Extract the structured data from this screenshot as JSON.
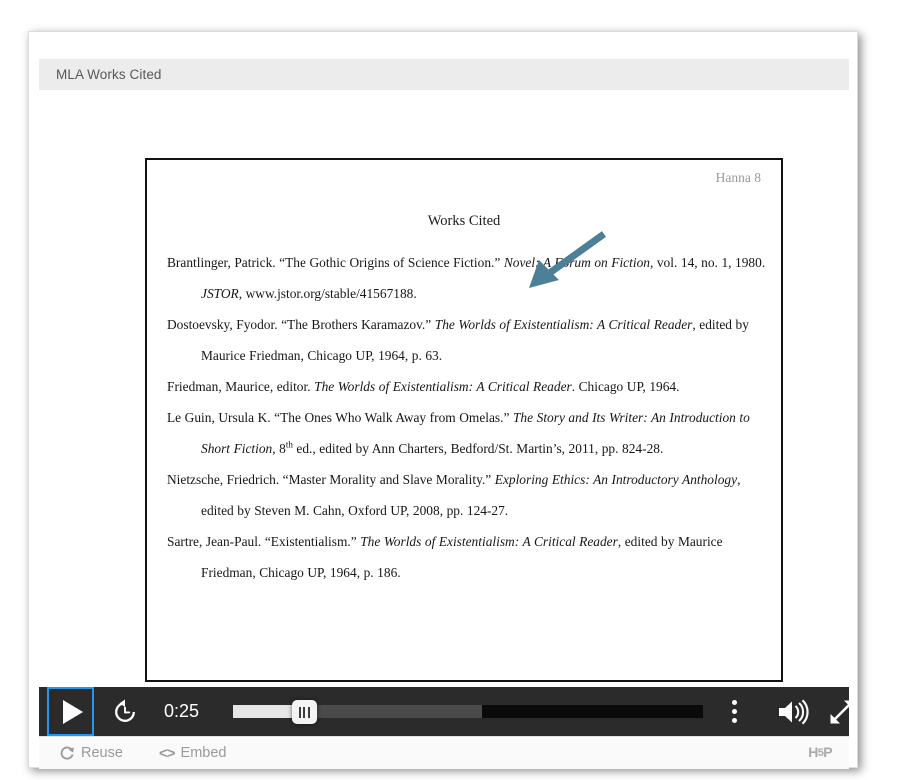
{
  "window": {
    "title": "MLA Works Cited"
  },
  "document": {
    "page_header": "Hanna 8",
    "heading": "Works Cited",
    "annotation": {
      "icon": "arrow-pointing-down-left",
      "color": "#4d7f96"
    },
    "citations": [
      {
        "id": "brantlinger",
        "parts": [
          {
            "text": "Brantlinger, Patrick. “The Gothic Origins of Science Fiction.” ",
            "style": "normal"
          },
          {
            "text": "Novel: A Forum on Fiction",
            "style": "italic"
          },
          {
            "text": ", vol. 14, no. 1, 1980. ",
            "style": "normal"
          },
          {
            "text": "JSTOR",
            "style": "italic"
          },
          {
            "text": ", www.jstor.org/stable/41567188.",
            "style": "normal"
          }
        ]
      },
      {
        "id": "dostoevsky",
        "parts": [
          {
            "text": "Dostoevsky, Fyodor. “The Brothers Karamazov.” ",
            "style": "normal"
          },
          {
            "text": "The Worlds of Existentialism: A Critical Reader",
            "style": "italic"
          },
          {
            "text": ", edited by Maurice Friedman, Chicago UP, 1964, p. 63.",
            "style": "normal"
          }
        ]
      },
      {
        "id": "friedman",
        "parts": [
          {
            "text": "Friedman, Maurice, editor. ",
            "style": "normal"
          },
          {
            "text": "The Worlds of Existentialism: A Critical Reader",
            "style": "italic"
          },
          {
            "text": ". Chicago UP, 1964.",
            "style": "normal"
          }
        ]
      },
      {
        "id": "le-guin",
        "parts": [
          {
            "text": "Le Guin, Ursula K. “The Ones Who Walk Away from Omelas.” ",
            "style": "normal"
          },
          {
            "text": "The Story and Its Writer: An Introduction to Short Fiction",
            "style": "italic"
          },
          {
            "text": ", 8",
            "style": "normal"
          },
          {
            "text": "th",
            "style": "superscript"
          },
          {
            "text": " ed., edited by Ann Charters, Bedford/St. Martin’s, 2011, pp. 824-28.",
            "style": "normal"
          }
        ]
      },
      {
        "id": "nietzsche",
        "parts": [
          {
            "text": "Nietzsche, Friedrich.  “Master Morality and Slave Morality.” ",
            "style": "normal"
          },
          {
            "text": "Exploring Ethics: An Introductory Anthology",
            "style": "italic"
          },
          {
            "text": ", edited by Steven M. Cahn, Oxford UP, 2008, pp. 124-27.",
            "style": "normal"
          }
        ]
      },
      {
        "id": "sartre",
        "parts": [
          {
            "text": "Sartre, Jean-Paul. “Existentialism.” ",
            "style": "normal"
          },
          {
            "text": "The Worlds of Existentialism: A Critical Reader",
            "style": "italic"
          },
          {
            "text": ", edited by Maurice Friedman, Chicago UP, 1964, p. 186.",
            "style": "normal"
          }
        ]
      }
    ]
  },
  "player": {
    "play_button": {
      "icon": "play-icon",
      "label": "Play",
      "focused": true
    },
    "rewind_button": {
      "icon": "rewind-clock-icon",
      "label": "Rewind"
    },
    "current_time": "0:25",
    "seek": {
      "played_percent": 15,
      "buffered_percent": 53,
      "handle_icon": "grip-handle-icon"
    },
    "menu_button": {
      "icon": "kebab-menu-icon",
      "label": "More options"
    },
    "volume_button": {
      "icon": "volume-high-icon",
      "label": "Volume"
    },
    "fullscreen_button": {
      "icon": "fullscreen-expand-icon",
      "label": "Fullscreen"
    },
    "focus_color": "#2196f3"
  },
  "actions": {
    "reuse": {
      "icon": "refresh-reuse-icon",
      "label": "Reuse"
    },
    "embed": {
      "icon": "code-brackets-icon",
      "label": "Embed"
    },
    "brand": {
      "prefix": "H",
      "mid": "5",
      "suffix": "P"
    }
  }
}
